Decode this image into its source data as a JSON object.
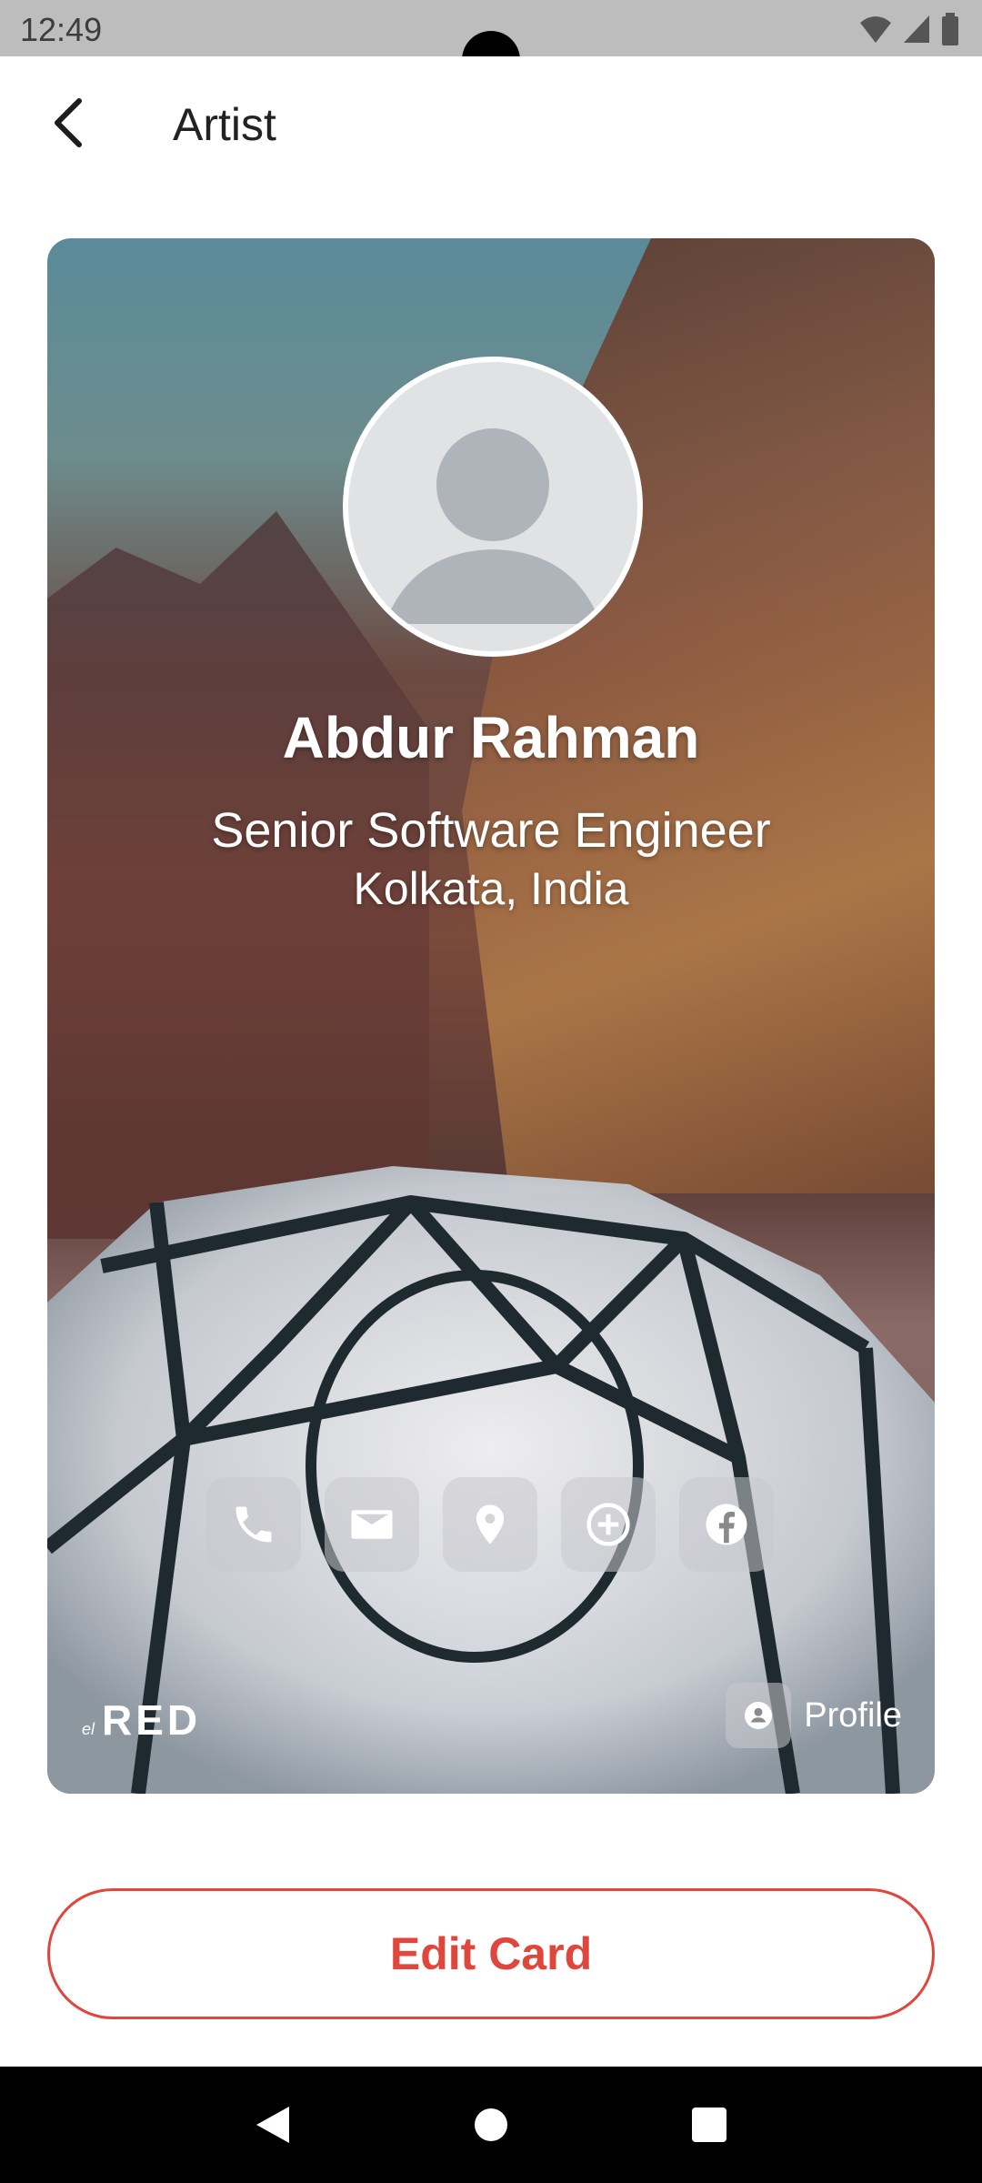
{
  "status_bar": {
    "time": "12:49",
    "icons": [
      "wifi-icon",
      "signal-icon",
      "battery-icon"
    ]
  },
  "app_bar": {
    "back_icon": "back-arrow-icon",
    "title": "Artist"
  },
  "card": {
    "avatar_icon": "person-placeholder-icon",
    "name": "Abdur Rahman",
    "job_title": "Senior Software Engineer",
    "location": "Kolkata, India",
    "actions": [
      {
        "icon": "phone-icon"
      },
      {
        "icon": "mail-icon"
      },
      {
        "icon": "location-pin-icon"
      },
      {
        "icon": "add-circle-icon"
      },
      {
        "icon": "facebook-icon"
      }
    ],
    "brand_small": "el",
    "brand_main": "RED",
    "profile_icon": "person-badge-icon",
    "profile_label": "Profile"
  },
  "edit_button": {
    "label": "Edit Card",
    "color": "#e0463c"
  },
  "nav_bar": {
    "buttons": [
      "back-triangle-icon",
      "home-circle-icon",
      "recents-square-icon"
    ]
  }
}
